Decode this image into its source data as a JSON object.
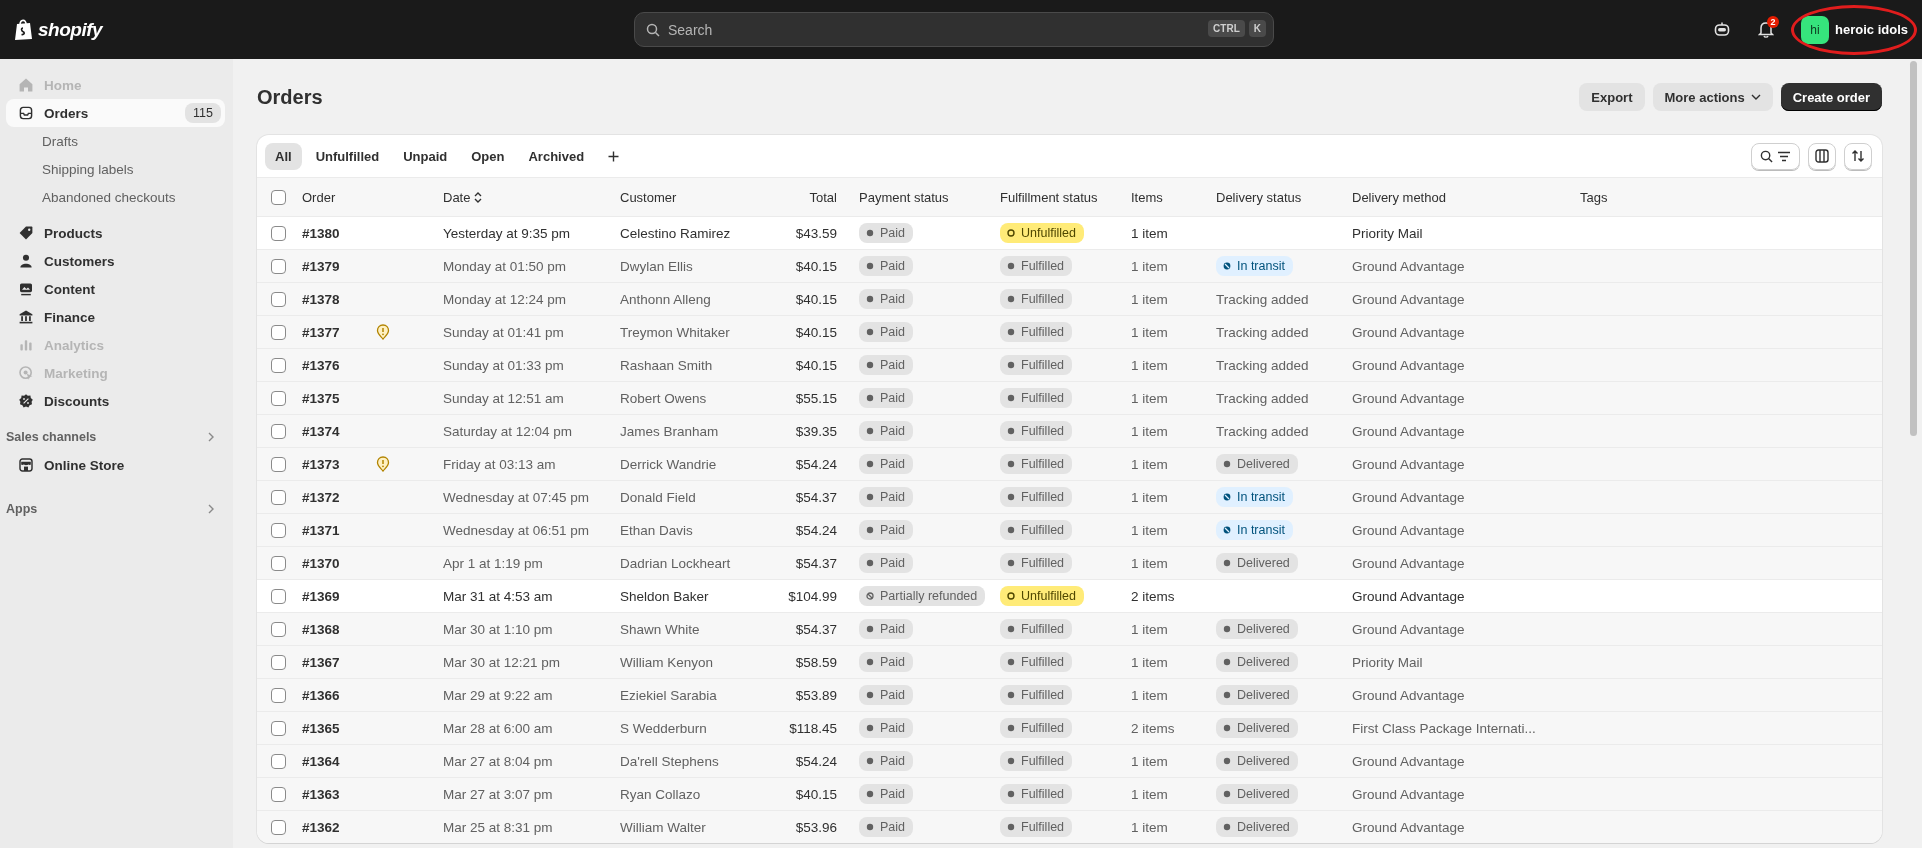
{
  "top_bar": {
    "logo_text": "shopify",
    "search": {
      "placeholder": "Search",
      "shortcut": [
        "CTRL",
        "K"
      ]
    },
    "notification_count": "2",
    "account": {
      "initials": "hi",
      "name": "heroic idols"
    }
  },
  "sidebar": {
    "items": [
      {
        "label": "Home",
        "selected": false,
        "disabled": true
      },
      {
        "label": "Orders",
        "selected": true,
        "disabled": false,
        "count": "115",
        "children": [
          {
            "label": "Drafts",
            "selected": false
          },
          {
            "label": "Shipping labels",
            "selected": false
          },
          {
            "label": "Abandoned checkouts",
            "selected": false
          }
        ]
      },
      {
        "label": "Products",
        "selected": false,
        "disabled": false
      },
      {
        "label": "Customers",
        "selected": false,
        "disabled": false
      },
      {
        "label": "Content",
        "selected": false,
        "disabled": false
      },
      {
        "label": "Finance",
        "selected": false,
        "disabled": false
      },
      {
        "label": "Analytics",
        "selected": false,
        "disabled": true
      },
      {
        "label": "Marketing",
        "selected": false,
        "disabled": true
      },
      {
        "label": "Discounts",
        "selected": false,
        "disabled": false
      }
    ],
    "sections": [
      {
        "label": "Sales channels",
        "items": [
          {
            "label": "Online Store",
            "selected": false
          }
        ]
      },
      {
        "label": "Apps"
      }
    ]
  },
  "page": {
    "title": "Orders",
    "actions": [
      {
        "label": "Export",
        "kind": "secondary"
      },
      {
        "label": "More actions",
        "kind": "menu"
      },
      {
        "label": "Create order",
        "kind": "primary"
      }
    ]
  },
  "tabs": [
    {
      "label": "All",
      "selected": true
    },
    {
      "label": "Unfulfilled",
      "selected": false
    },
    {
      "label": "Unpaid",
      "selected": false
    },
    {
      "label": "Open",
      "selected": false
    },
    {
      "label": "Archived",
      "selected": false
    }
  ],
  "table": {
    "all_checked": false,
    "columns": [
      {
        "label": "Order",
        "sorted": false
      },
      {
        "label": "Date",
        "sorted": true
      },
      {
        "label": "Customer",
        "sorted": false
      },
      {
        "label": "Total",
        "sorted": false
      },
      {
        "label": "Payment status",
        "sorted": false
      },
      {
        "label": "Fulfillment status",
        "sorted": false
      },
      {
        "label": "Items",
        "sorted": false
      },
      {
        "label": "Delivery status",
        "sorted": false
      },
      {
        "label": "Delivery method",
        "sorted": false
      },
      {
        "label": "Tags",
        "sorted": false
      }
    ],
    "rows": [
      {
        "checked": false,
        "order": "#1380",
        "flagged": false,
        "date": "Yesterday at 9:35 pm",
        "customer": "Celestino Ramirez",
        "total": "$43.59",
        "payment": {
          "label": "Paid",
          "kind": "paid"
        },
        "fulfillment": {
          "label": "Unfulfilled",
          "kind": "unfulfilled"
        },
        "items": "1 item",
        "delivery_method": "Priority Mail"
      },
      {
        "checked": false,
        "order": "#1379",
        "flagged": false,
        "date": "Monday at 01:50 pm",
        "customer": "Dwylan Ellis",
        "total": "$40.15",
        "payment": {
          "label": "Paid",
          "kind": "paid"
        },
        "fulfillment": {
          "label": "Fulfilled",
          "kind": "fulfilled"
        },
        "items": "1 item",
        "delivery": {
          "label": "In transit",
          "kind": "in_transit"
        },
        "delivery_method": "Ground Advantage"
      },
      {
        "checked": false,
        "order": "#1378",
        "flagged": false,
        "date": "Monday at 12:24 pm",
        "customer": "Anthonn Alleng",
        "total": "$40.15",
        "payment": {
          "label": "Paid",
          "kind": "paid"
        },
        "fulfillment": {
          "label": "Fulfilled",
          "kind": "fulfilled"
        },
        "items": "1 item",
        "delivery": {
          "label": "Tracking added",
          "kind": "text"
        },
        "delivery_method": "Ground Advantage"
      },
      {
        "checked": false,
        "order": "#1377",
        "flagged": true,
        "date": "Sunday at 01:41 pm",
        "customer": "Treymon Whitaker",
        "total": "$40.15",
        "payment": {
          "label": "Paid",
          "kind": "paid"
        },
        "fulfillment": {
          "label": "Fulfilled",
          "kind": "fulfilled"
        },
        "items": "1 item",
        "delivery": {
          "label": "Tracking added",
          "kind": "text"
        },
        "delivery_method": "Ground Advantage"
      },
      {
        "checked": false,
        "order": "#1376",
        "flagged": false,
        "date": "Sunday at 01:33 pm",
        "customer": "Rashaan Smith",
        "total": "$40.15",
        "payment": {
          "label": "Paid",
          "kind": "paid"
        },
        "fulfillment": {
          "label": "Fulfilled",
          "kind": "fulfilled"
        },
        "items": "1 item",
        "delivery": {
          "label": "Tracking added",
          "kind": "text"
        },
        "delivery_method": "Ground Advantage"
      },
      {
        "checked": false,
        "order": "#1375",
        "flagged": false,
        "date": "Sunday at 12:51 am",
        "customer": "Robert Owens",
        "total": "$55.15",
        "payment": {
          "label": "Paid",
          "kind": "paid"
        },
        "fulfillment": {
          "label": "Fulfilled",
          "kind": "fulfilled"
        },
        "items": "1 item",
        "delivery": {
          "label": "Tracking added",
          "kind": "text"
        },
        "delivery_method": "Ground Advantage"
      },
      {
        "checked": false,
        "order": "#1374",
        "flagged": false,
        "date": "Saturday at 12:04 pm",
        "customer": "James Branham",
        "total": "$39.35",
        "payment": {
          "label": "Paid",
          "kind": "paid"
        },
        "fulfillment": {
          "label": "Fulfilled",
          "kind": "fulfilled"
        },
        "items": "1 item",
        "delivery": {
          "label": "Tracking added",
          "kind": "text"
        },
        "delivery_method": "Ground Advantage"
      },
      {
        "checked": false,
        "order": "#1373",
        "flagged": true,
        "date": "Friday at 03:13 am",
        "customer": "Derrick Wandrie",
        "total": "$54.24",
        "payment": {
          "label": "Paid",
          "kind": "paid"
        },
        "fulfillment": {
          "label": "Fulfilled",
          "kind": "fulfilled"
        },
        "items": "1 item",
        "delivery": {
          "label": "Delivered",
          "kind": "delivered"
        },
        "delivery_method": "Ground Advantage"
      },
      {
        "checked": false,
        "order": "#1372",
        "flagged": false,
        "date": "Wednesday at 07:45 pm",
        "customer": "Donald Field",
        "total": "$54.37",
        "payment": {
          "label": "Paid",
          "kind": "paid"
        },
        "fulfillment": {
          "label": "Fulfilled",
          "kind": "fulfilled"
        },
        "items": "1 item",
        "delivery": {
          "label": "In transit",
          "kind": "in_transit"
        },
        "delivery_method": "Ground Advantage"
      },
      {
        "checked": false,
        "order": "#1371",
        "flagged": false,
        "date": "Wednesday at 06:51 pm",
        "customer": "Ethan Davis",
        "total": "$54.24",
        "payment": {
          "label": "Paid",
          "kind": "paid"
        },
        "fulfillment": {
          "label": "Fulfilled",
          "kind": "fulfilled"
        },
        "items": "1 item",
        "delivery": {
          "label": "In transit",
          "kind": "in_transit"
        },
        "delivery_method": "Ground Advantage"
      },
      {
        "checked": false,
        "order": "#1370",
        "flagged": false,
        "date": "Apr 1 at 1:19 pm",
        "customer": "Dadrian Lockheart",
        "total": "$54.37",
        "payment": {
          "label": "Paid",
          "kind": "paid"
        },
        "fulfillment": {
          "label": "Fulfilled",
          "kind": "fulfilled"
        },
        "items": "1 item",
        "delivery": {
          "label": "Delivered",
          "kind": "delivered"
        },
        "delivery_method": "Ground Advantage"
      },
      {
        "checked": false,
        "order": "#1369",
        "flagged": false,
        "date": "Mar 31 at 4:53 am",
        "customer": "Sheldon Baker",
        "total": "$104.99",
        "payment": {
          "label": "Partially refunded",
          "kind": "partially_refunded"
        },
        "fulfillment": {
          "label": "Unfulfilled",
          "kind": "unfulfilled"
        },
        "items": "2 items",
        "delivery_method": "Ground Advantage"
      },
      {
        "checked": false,
        "order": "#1368",
        "flagged": false,
        "date": "Mar 30 at 1:10 pm",
        "customer": "Shawn White",
        "total": "$54.37",
        "payment": {
          "label": "Paid",
          "kind": "paid"
        },
        "fulfillment": {
          "label": "Fulfilled",
          "kind": "fulfilled"
        },
        "items": "1 item",
        "delivery": {
          "label": "Delivered",
          "kind": "delivered"
        },
        "delivery_method": "Ground Advantage"
      },
      {
        "checked": false,
        "order": "#1367",
        "flagged": false,
        "date": "Mar 30 at 12:21 pm",
        "customer": "William Kenyon",
        "total": "$58.59",
        "payment": {
          "label": "Paid",
          "kind": "paid"
        },
        "fulfillment": {
          "label": "Fulfilled",
          "kind": "fulfilled"
        },
        "items": "1 item",
        "delivery": {
          "label": "Delivered",
          "kind": "delivered"
        },
        "delivery_method": "Priority Mail"
      },
      {
        "checked": false,
        "order": "#1366",
        "flagged": false,
        "date": "Mar 29 at 9:22 am",
        "customer": "Eziekiel Sarabia",
        "total": "$53.89",
        "payment": {
          "label": "Paid",
          "kind": "paid"
        },
        "fulfillment": {
          "label": "Fulfilled",
          "kind": "fulfilled"
        },
        "items": "1 item",
        "delivery": {
          "label": "Delivered",
          "kind": "delivered"
        },
        "delivery_method": "Ground Advantage"
      },
      {
        "checked": false,
        "order": "#1365",
        "flagged": false,
        "date": "Mar 28 at 6:00 am",
        "customer": "S Wedderburn",
        "total": "$118.45",
        "payment": {
          "label": "Paid",
          "kind": "paid"
        },
        "fulfillment": {
          "label": "Fulfilled",
          "kind": "fulfilled"
        },
        "items": "2 items",
        "delivery": {
          "label": "Delivered",
          "kind": "delivered"
        },
        "delivery_method": "First Class Package Internati..."
      },
      {
        "checked": false,
        "order": "#1364",
        "flagged": false,
        "date": "Mar 27 at 8:04 pm",
        "customer": "Da'rell Stephens",
        "total": "$54.24",
        "payment": {
          "label": "Paid",
          "kind": "paid"
        },
        "fulfillment": {
          "label": "Fulfilled",
          "kind": "fulfilled"
        },
        "items": "1 item",
        "delivery": {
          "label": "Delivered",
          "kind": "delivered"
        },
        "delivery_method": "Ground Advantage"
      },
      {
        "checked": false,
        "order": "#1363",
        "flagged": false,
        "date": "Mar 27 at 3:07 pm",
        "customer": "Ryan Collazo",
        "total": "$40.15",
        "payment": {
          "label": "Paid",
          "kind": "paid"
        },
        "fulfillment": {
          "label": "Fulfilled",
          "kind": "fulfilled"
        },
        "items": "1 item",
        "delivery": {
          "label": "Delivered",
          "kind": "delivered"
        },
        "delivery_method": "Ground Advantage"
      },
      {
        "checked": false,
        "order": "#1362",
        "flagged": false,
        "date": "Mar 25 at 8:31 pm",
        "customer": "William Walter",
        "total": "$53.96",
        "payment": {
          "label": "Paid",
          "kind": "paid"
        },
        "fulfillment": {
          "label": "Fulfilled",
          "kind": "fulfilled"
        },
        "items": "1 item",
        "delivery": {
          "label": "Delivered",
          "kind": "delivered"
        },
        "delivery_method": "Ground Advantage"
      }
    ]
  }
}
